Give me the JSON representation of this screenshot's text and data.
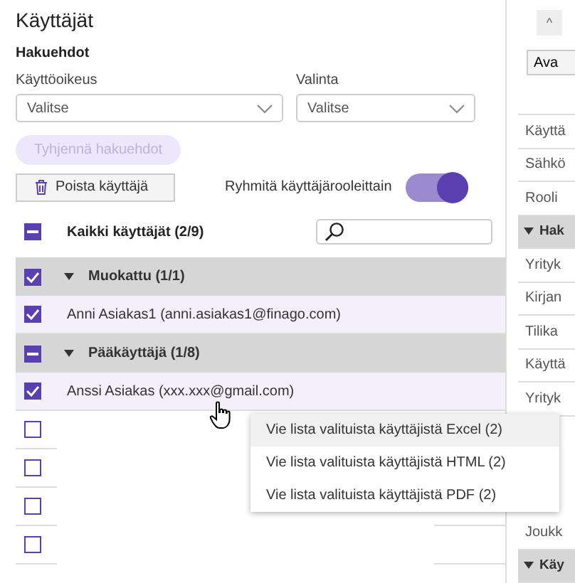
{
  "title": "Käyttäjät",
  "filters": {
    "heading": "Hakuehdot",
    "fields": [
      {
        "label": "Käyttöoikeus",
        "value": "Valitse"
      },
      {
        "label": "Valinta",
        "value": "Valitse"
      }
    ],
    "clear_button": {
      "label": "Tyhjennä hakuehdot",
      "disabled": true
    }
  },
  "toolbar": {
    "delete_button": "Poista käyttäjä",
    "group_toggle": {
      "label": "Ryhmitä käyttäjärooleittain",
      "on": true
    }
  },
  "tree": {
    "root": {
      "label": "Kaikki käyttäjät (2/9)",
      "checked": true,
      "partial": true
    },
    "rows": [
      {
        "kind": "group",
        "label": "Muokattu (1/1)",
        "checked": true,
        "partial": false,
        "expanded": true
      },
      {
        "kind": "user",
        "label": "Anni Asiakas1 (anni.asiakas1@finago.com)",
        "checked": true,
        "partial": false
      },
      {
        "kind": "group",
        "label": "Pääkäyttäjä (1/8)",
        "checked": true,
        "partial": true,
        "expanded": true
      },
      {
        "kind": "user",
        "label": "Anssi Asiakas (xxx.xxx@gmail.com)",
        "checked": true,
        "partial": false
      },
      {
        "kind": "hidden",
        "checked": false,
        "partial": false
      },
      {
        "kind": "hidden",
        "checked": false,
        "partial": false
      },
      {
        "kind": "hidden",
        "checked": false,
        "partial": false
      },
      {
        "kind": "hidden",
        "checked": false,
        "partial": false
      }
    ]
  },
  "context_menu": [
    {
      "label": "Vie lista valituista käyttäjistä Excel (2)",
      "selected": true
    },
    {
      "label": "Vie lista valituista käyttäjistä HTML (2)",
      "selected": false
    },
    {
      "label": "Vie lista valituista käyttäjistä PDF (2)",
      "selected": false
    }
  ],
  "side_panel": {
    "collapse_button": "^",
    "open_button": "Ava",
    "rows": [
      {
        "kind": "item",
        "label": "Käyttä"
      },
      {
        "kind": "item",
        "label": "Sähkö"
      },
      {
        "kind": "item",
        "label": "Rooli"
      },
      {
        "kind": "group",
        "label": "Hak"
      },
      {
        "kind": "item",
        "label": "Yrityk"
      },
      {
        "kind": "item",
        "label": "Kirjan"
      },
      {
        "kind": "item",
        "label": "Tilika"
      },
      {
        "kind": "item",
        "label": "Käyttä"
      },
      {
        "kind": "item",
        "label": "Yrityk"
      },
      {
        "kind": "gap"
      },
      {
        "kind": "gap"
      },
      {
        "kind": "gap"
      },
      {
        "kind": "item",
        "label": "Joukk"
      },
      {
        "kind": "group",
        "label": "Käy"
      }
    ]
  }
}
